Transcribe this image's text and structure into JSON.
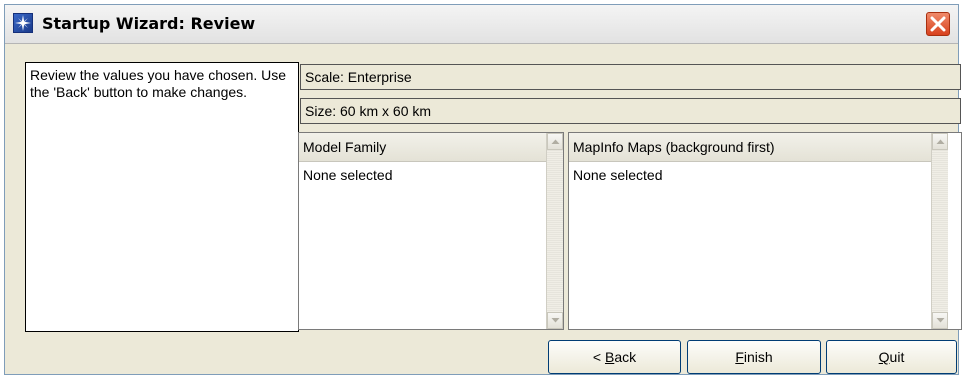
{
  "window": {
    "title": "Startup Wizard: Review"
  },
  "intro": {
    "text": "Review the values you have chosen. Use the 'Back' button to make changes."
  },
  "fields": {
    "scale": "Scale: Enterprise",
    "size": "Size: 60 km x 60 km"
  },
  "lists": [
    {
      "header": "Model Family",
      "content": "None selected"
    },
    {
      "header": "MapInfo Maps (background first)",
      "content": "None selected"
    }
  ],
  "buttons": {
    "back": {
      "prefix": "< ",
      "mnemonic": "B",
      "rest": "ack"
    },
    "finish": {
      "mnemonic": "F",
      "rest": "inish"
    },
    "quit": {
      "mnemonic": "Q",
      "rest": "uit"
    }
  },
  "icons": {
    "app": "compass-star-icon",
    "close": "close-icon",
    "scroll_up": "scroll-up-arrow-icon",
    "scroll_down": "scroll-down-arrow-icon"
  },
  "colors": {
    "close_button": "#d8411e",
    "app_icon": "#2a56b8",
    "window_bg": "#ece9d8"
  }
}
